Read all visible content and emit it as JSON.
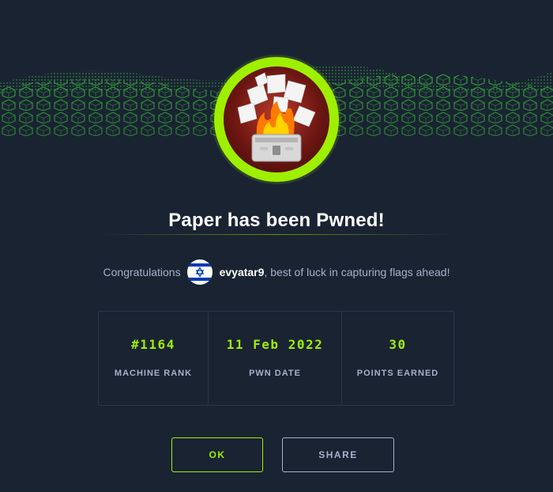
{
  "title": "Paper has been Pwned!",
  "congrats": {
    "prefix": "Congratulations",
    "username": "evyatar9",
    "suffix": ", best of luck in capturing flags ahead!",
    "flag_icon": "israel-flag-icon"
  },
  "stats": [
    {
      "value": "#1164",
      "label": "MACHINE RANK"
    },
    {
      "value": "11 Feb 2022",
      "label": "PWN DATE"
    },
    {
      "value": "30",
      "label": "POINTS EARNED"
    }
  ],
  "buttons": {
    "ok": "OK",
    "share": "SHARE"
  },
  "colors": {
    "background": "#1a2332",
    "accent": "#9fef00",
    "text_muted": "#a4b1cd",
    "border": "#2a3548"
  },
  "icons": {
    "banner": "green-cube-wave-banner",
    "machine_avatar": "burning-printer-icon"
  }
}
